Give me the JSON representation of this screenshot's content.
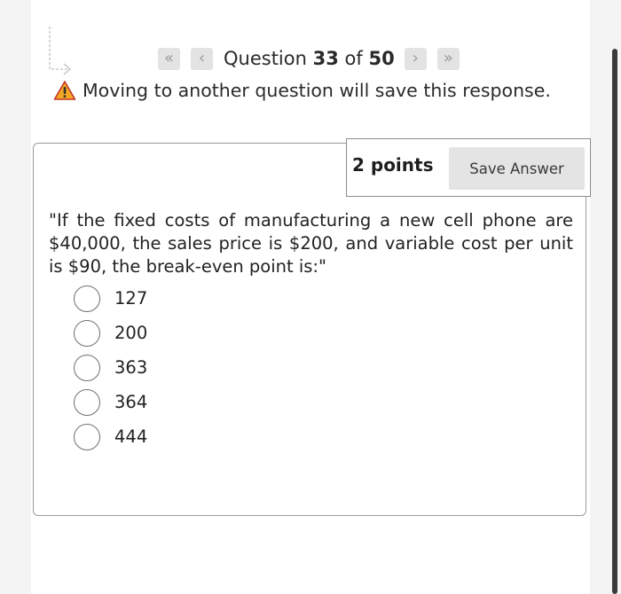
{
  "navigation": {
    "first_icon": "double-chevron-left-icon",
    "prev_icon": "chevron-left-icon",
    "next_icon": "chevron-right-icon",
    "last_icon": "double-chevron-right-icon",
    "first_glyph": "«",
    "prev_glyph": "‹",
    "next_glyph": "›",
    "last_glyph": "»",
    "question_prefix": "Question",
    "current_question": "33",
    "of_text": "of",
    "total_questions": "50"
  },
  "warning": {
    "icon": "warning-triangle-icon",
    "text": "Moving to another question will save this response."
  },
  "question": {
    "points": "2 points",
    "save_label": "Save Answer",
    "text": "\"If the fixed costs of manufacturing a new cell phone are $40,000, the sales price is $200, and variable cost per unit is $90, the break-even point is:\"",
    "options": [
      {
        "label": "127"
      },
      {
        "label": "200"
      },
      {
        "label": "363"
      },
      {
        "label": "364"
      },
      {
        "label": "444"
      }
    ]
  },
  "colors": {
    "warning_fill": "#f5a623",
    "card_border": "#9b9b9b",
    "button_bg": "#e4e4e4"
  }
}
